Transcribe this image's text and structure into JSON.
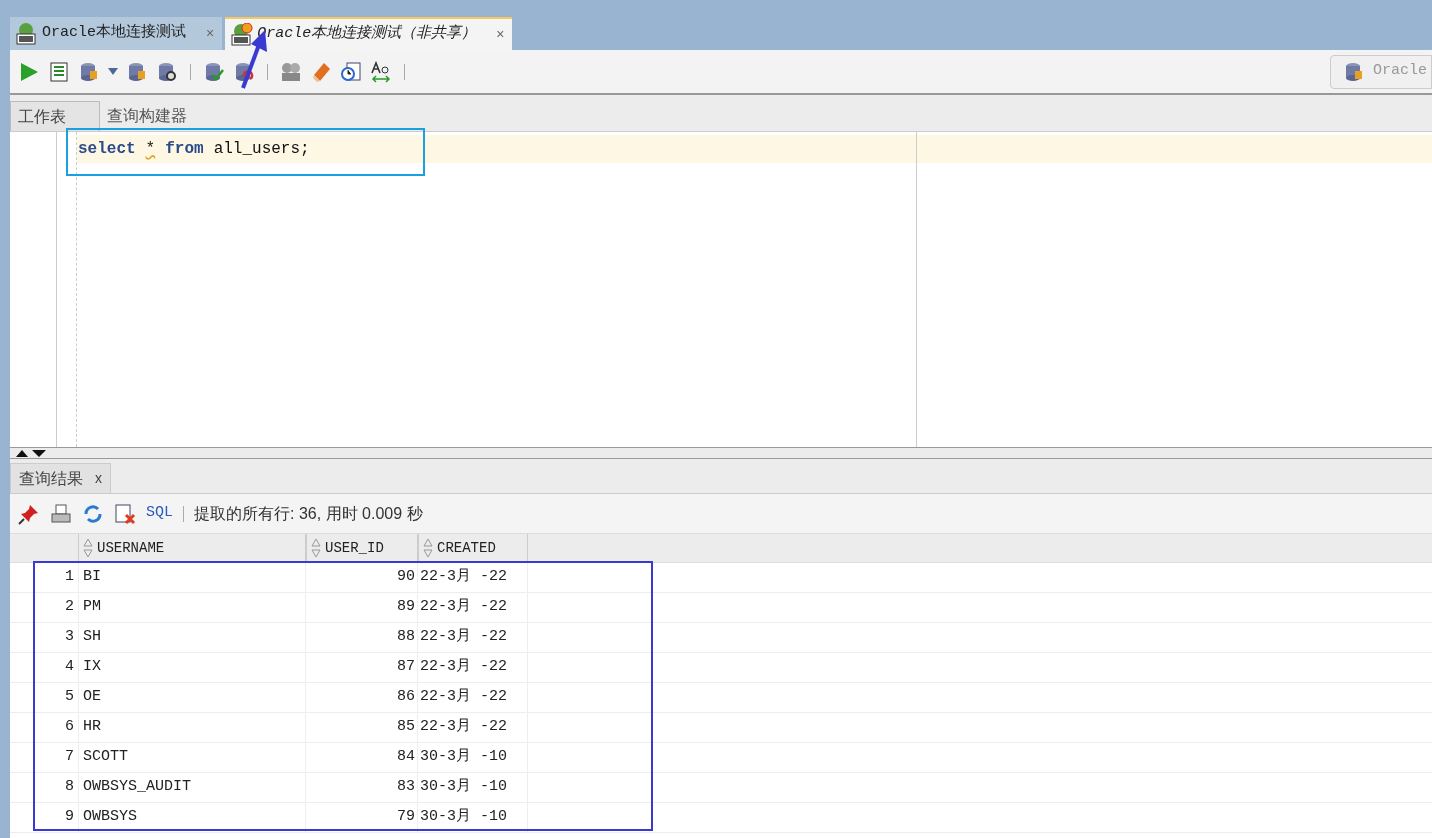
{
  "doc_tabs": [
    {
      "label": "Oracle本地连接测试",
      "selected": false,
      "close": "×",
      "kind": "sql"
    },
    {
      "label": "Oracle本地连接测试（非共享）",
      "selected": true,
      "close": "×",
      "kind": "unshared"
    }
  ],
  "connection_button": {
    "label": "Oracle"
  },
  "editor_tabs": [
    {
      "label": "工作表",
      "selected": true
    },
    {
      "label": "查询构建器",
      "selected": false
    }
  ],
  "code_line": [
    {
      "text": "select",
      "kind": "keyword"
    },
    {
      "text": "*",
      "kind": "warning"
    },
    {
      "text": "from",
      "kind": "keyword"
    },
    {
      "text": "all_users;",
      "kind": "plain"
    }
  ],
  "results_tab": {
    "label": "查询结果",
    "close": "x"
  },
  "results_toolbar": {
    "sql_link": "SQL",
    "status": "提取的所有行: 36, 用时 0.009 秒"
  },
  "table": {
    "columns": [
      "USERNAME",
      "USER_ID",
      "CREATED"
    ],
    "rows": [
      {
        "number": "1",
        "cells": [
          "BI",
          "90",
          "22-3月 -22"
        ]
      },
      {
        "number": "2",
        "cells": [
          "PM",
          "89",
          "22-3月 -22"
        ]
      },
      {
        "number": "3",
        "cells": [
          "SH",
          "88",
          "22-3月 -22"
        ]
      },
      {
        "number": "4",
        "cells": [
          "IX",
          "87",
          "22-3月 -22"
        ]
      },
      {
        "number": "5",
        "cells": [
          "OE",
          "86",
          "22-3月 -22"
        ]
      },
      {
        "number": "6",
        "cells": [
          "HR",
          "85",
          "22-3月 -22"
        ]
      },
      {
        "number": "7",
        "cells": [
          "SCOTT",
          "84",
          "30-3月 -10"
        ]
      },
      {
        "number": "8",
        "cells": [
          "OWBSYS_AUDIT",
          "83",
          "30-3月 -10"
        ]
      },
      {
        "number": "9",
        "cells": [
          "OWBSYS",
          "79",
          "30-3月 -10"
        ]
      }
    ]
  }
}
